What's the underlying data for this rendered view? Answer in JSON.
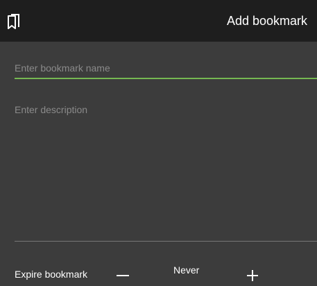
{
  "header": {
    "title": "Add bookmark",
    "icon": "bookmarks-icon"
  },
  "form": {
    "name_placeholder": "Enter bookmark name",
    "name_value": "",
    "description_placeholder": "Enter description",
    "description_value": "",
    "accent_color": "#76b852"
  },
  "expire": {
    "label": "Expire bookmark",
    "value": "Never",
    "decrement_icon": "minus-icon",
    "increment_icon": "plus-icon"
  }
}
